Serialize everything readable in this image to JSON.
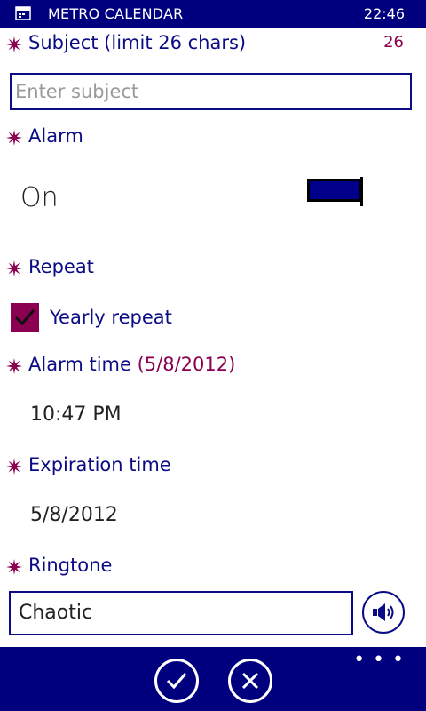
{
  "statusbar": {
    "app_title": "METRO CALENDAR",
    "clock": "22:46"
  },
  "subject": {
    "label": "Subject (limit 26 chars)",
    "remaining": "26",
    "placeholder": "Enter subject",
    "value": ""
  },
  "alarm": {
    "label": "Alarm",
    "state_label": "On",
    "enabled": true
  },
  "repeat": {
    "label": "Repeat",
    "checkbox_label": "Yearly repeat",
    "checked": true
  },
  "alarm_time": {
    "label": "Alarm time",
    "date": "(5/8/2012)",
    "value": "10:47 PM"
  },
  "expiration_time": {
    "label": "Expiration time",
    "value": "5/8/2012"
  },
  "ringtone": {
    "label": "Ringtone",
    "value": "Chaotic"
  },
  "appbar": {
    "more_label": "• • •",
    "icons": [
      "check-icon",
      "close-icon"
    ]
  },
  "colors": {
    "accent": "#00007f",
    "label": "#0b0b86",
    "highlight": "#8b0050",
    "toggle_fill": "#00008b"
  }
}
